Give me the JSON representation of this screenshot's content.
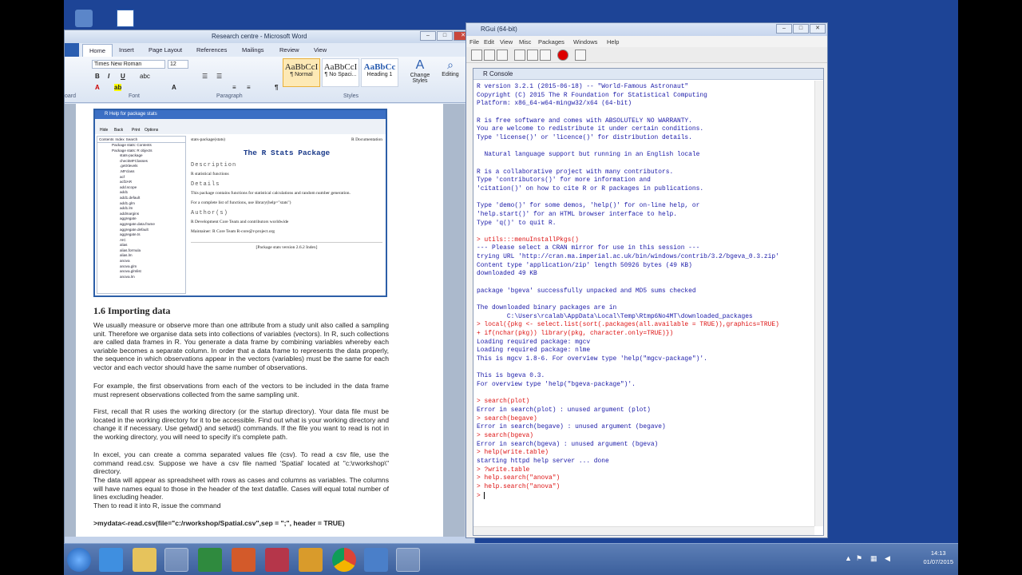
{
  "word": {
    "title": "Research centre - Microsoft Word",
    "tabs": [
      "Home",
      "Insert",
      "Page Layout",
      "References",
      "Mailings",
      "Review",
      "View"
    ],
    "font": "Times New Roman",
    "size": "12",
    "styles": [
      {
        "sample": "AaBbCcI",
        "name": "¶ Normal"
      },
      {
        "sample": "AaBbCcI",
        "name": "¶ No Spaci..."
      },
      {
        "sample": "AaBbCc",
        "name": "Heading 1"
      }
    ],
    "change_styles": "Change Styles",
    "editing": "Editing",
    "groups": [
      "oard",
      "Font",
      "Paragraph",
      "Styles"
    ]
  },
  "rhelp": {
    "title": "R Help for package stats",
    "tool": [
      "Hide",
      "Back",
      "Print",
      "Options"
    ],
    "tree_tabs": [
      "Contents",
      "Index",
      "Search"
    ],
    "tree_top": [
      "Package stats: Contents",
      "Package stats: R objects"
    ],
    "tree_items": [
      "stats-package",
      "checkMFClasses",
      ".getXlevels",
      ".MFclass",
      "acf",
      "acf2AR",
      "add.scope",
      "add1",
      "add1.default",
      "add1.glm",
      "add1.lm",
      "addmargins",
      "aggregate",
      "aggregate.data.frame",
      "aggregate.default",
      "aggregate.ts",
      "AIC",
      "alias",
      "alias.formula",
      "alias.lm",
      "anova",
      "anova.glm",
      "anova.glmlist",
      "anova.lm"
    ],
    "hdr_left": "stats-package(stats)",
    "hdr_right": "R Documentation",
    "heading": "The R Stats Package",
    "description_h": "Description",
    "description": "R statistical functions",
    "details_h": "Details",
    "details": "This package contains functions for statistical calculations and random number generation.",
    "details2": "For a complete list of functions, use library(help=\"stats\")",
    "authors_h": "Author(s)",
    "authors": "R Development Core Team and contributors worldwide",
    "maintainer": "Maintainer: R Core Team R-core@r-project.org",
    "footer": "[Package stats version 2.6.2 Index]"
  },
  "doc": {
    "heading": "1.6 Importing data",
    "p1": "We usually measure or observe more than one attribute from a study unit also called a sampling unit. Therefore we organise data sets into collections of variables (vectors). In R, such collections are called data frames in R. You generate a data frame by combining variables whereby each variable becomes a separate column. In order that a data frame to represents the data properly, the sequence in which observations appear in the vectors (variables) must be the same for each vector and each vector should have the same number of observations.",
    "p2": "For example, the first observations from each of the vectors to be included in the data frame must represent observations collected from the same sampling unit.",
    "p3": "First, recall that R uses the working directory (or the startup directory). Your data file must be located in the working directory for it to be accessible. Find out what is your working directory and change it if necessary. Use getwd() and setwd() commands. If the file you want to read is not in the working directory, you will need to specify it's complete path.",
    "p4": "In excel, you can create a comma separated values file (csv). To read a csv file, use the command read.csv. Suppose we have a csv file named 'Spatial' located at \"c:\\rworkshop\\\" directory.",
    "p5": "The data will appear as spreadsheet with rows as cases and columns as variables. The columns will have names equal to those in the header of the text datafile. Cases will equal total number of lines excluding header.",
    "p6": "Then to read it into R, issue the command",
    "p7": ">mydata<-read.csv(file=\"c:/rworkshop/Spatial.csv\",sep = \";\", header = TRUE)"
  },
  "rgui": {
    "title": "RGui (64-bit)",
    "menu": [
      "File",
      "Edit",
      "View",
      "Misc",
      "Packages",
      "Windows",
      "Help"
    ],
    "console_title": "R Console",
    "lines": [
      {
        "c": "out",
        "t": "R version 3.2.1 (2015-06-18) -- \"World-Famous Astronaut\""
      },
      {
        "c": "out",
        "t": "Copyright (C) 2015 The R Foundation for Statistical Computing"
      },
      {
        "c": "out",
        "t": "Platform: x86_64-w64-mingw32/x64 (64-bit)"
      },
      {
        "c": "out",
        "t": ""
      },
      {
        "c": "out",
        "t": "R is free software and comes with ABSOLUTELY NO WARRANTY."
      },
      {
        "c": "out",
        "t": "You are welcome to redistribute it under certain conditions."
      },
      {
        "c": "out",
        "t": "Type 'license()' or 'licence()' for distribution details."
      },
      {
        "c": "out",
        "t": ""
      },
      {
        "c": "out",
        "t": "  Natural language support but running in an English locale"
      },
      {
        "c": "out",
        "t": ""
      },
      {
        "c": "out",
        "t": "R is a collaborative project with many contributors."
      },
      {
        "c": "out",
        "t": "Type 'contributors()' for more information and"
      },
      {
        "c": "out",
        "t": "'citation()' on how to cite R or R packages in publications."
      },
      {
        "c": "out",
        "t": ""
      },
      {
        "c": "out",
        "t": "Type 'demo()' for some demos, 'help()' for on-line help, or"
      },
      {
        "c": "out",
        "t": "'help.start()' for an HTML browser interface to help."
      },
      {
        "c": "out",
        "t": "Type 'q()' to quit R."
      },
      {
        "c": "out",
        "t": ""
      },
      {
        "c": "cmd",
        "t": "> utils:::menuInstallPkgs()"
      },
      {
        "c": "out",
        "t": "--- Please select a CRAN mirror for use in this session ---"
      },
      {
        "c": "out",
        "t": "trying URL 'http://cran.ma.imperial.ac.uk/bin/windows/contrib/3.2/bgeva_0.3.zip'"
      },
      {
        "c": "out",
        "t": "Content type 'application/zip' length 50926 bytes (49 KB)"
      },
      {
        "c": "out",
        "t": "downloaded 49 KB"
      },
      {
        "c": "out",
        "t": ""
      },
      {
        "c": "out",
        "t": "package 'bgeva' successfully unpacked and MD5 sums checked"
      },
      {
        "c": "out",
        "t": ""
      },
      {
        "c": "out",
        "t": "The downloaded binary packages are in"
      },
      {
        "c": "out",
        "t": "        C:\\Users\\rcalab\\AppData\\Local\\Temp\\Rtmp6No4MT\\downloaded_packages"
      },
      {
        "c": "cmd",
        "t": "> local({pkg <- select.list(sort(.packages(all.available = TRUE)),graphics=TRUE)"
      },
      {
        "c": "cmd",
        "t": "+ if(nchar(pkg)) library(pkg, character.only=TRUE)})"
      },
      {
        "c": "out",
        "t": "Loading required package: mgcv"
      },
      {
        "c": "out",
        "t": "Loading required package: nlme"
      },
      {
        "c": "out",
        "t": "This is mgcv 1.8-6. For overview type 'help(\"mgcv-package\")'."
      },
      {
        "c": "out",
        "t": ""
      },
      {
        "c": "out",
        "t": "This is bgeva 0.3."
      },
      {
        "c": "out",
        "t": "For overview type 'help(\"bgeva-package\")'."
      },
      {
        "c": "out",
        "t": ""
      },
      {
        "c": "cmd",
        "t": "> search(plot)"
      },
      {
        "c": "out",
        "t": "Error in search(plot) : unused argument (plot)"
      },
      {
        "c": "cmd",
        "t": "> search(begave)"
      },
      {
        "c": "out",
        "t": "Error in search(begave) : unused argument (begave)"
      },
      {
        "c": "cmd",
        "t": "> search(bgeva)"
      },
      {
        "c": "out",
        "t": "Error in search(bgeva) : unused argument (bgeva)"
      },
      {
        "c": "cmd",
        "t": "> help(write.table)"
      },
      {
        "c": "out",
        "t": "starting httpd help server ... done"
      },
      {
        "c": "cmd",
        "t": "> ?write.table"
      },
      {
        "c": "cmd",
        "t": "> help.search(\"anova\")"
      },
      {
        "c": "cmd",
        "t": "> help.search(\"anova\")"
      },
      {
        "c": "cmd",
        "t": "> "
      }
    ]
  },
  "taskbar": {
    "time": "14:13",
    "date": "01/07/2015"
  }
}
